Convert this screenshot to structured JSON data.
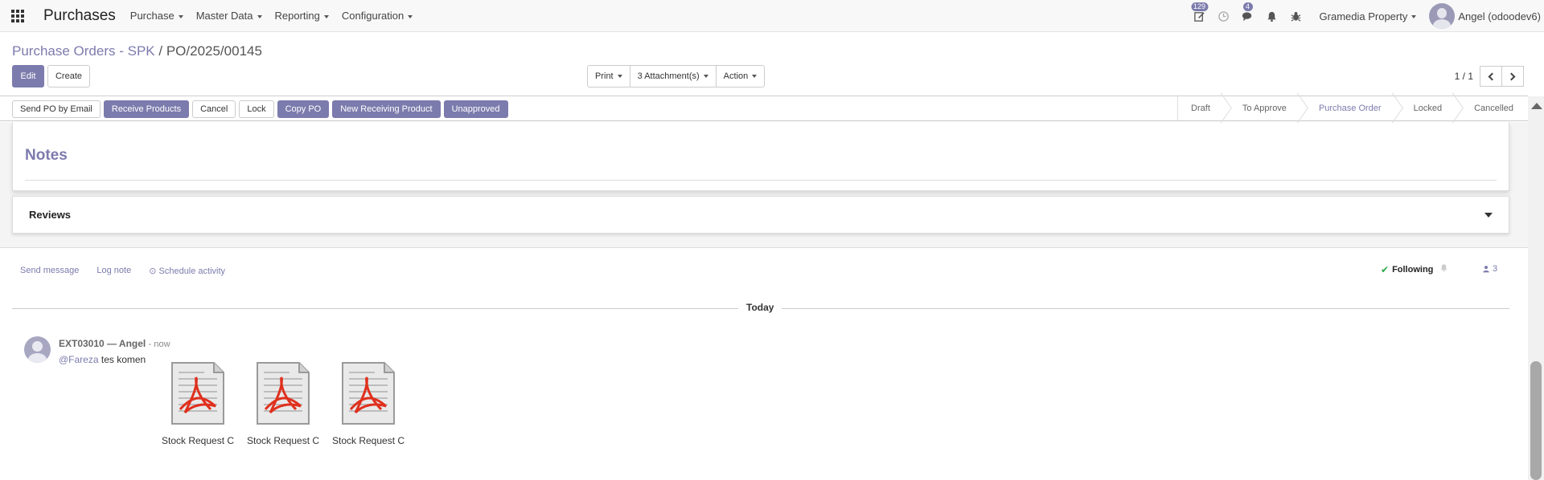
{
  "navbar": {
    "brand": "Purchases",
    "menus": [
      "Purchase",
      "Master Data",
      "Reporting",
      "Configuration"
    ],
    "activity_badge": "129",
    "messages_badge": "4",
    "company": "Gramedia Property",
    "user": "Angel (odoodev6)"
  },
  "breadcrumb": {
    "parent": "Purchase Orders - SPK",
    "separator": "/",
    "current": "PO/2025/00145"
  },
  "buttons": {
    "edit": "Edit",
    "create": "Create",
    "print": "Print",
    "attachments": "3 Attachment(s)",
    "action": "Action"
  },
  "pager": {
    "value": "1 / 1"
  },
  "status_actions": [
    "Send PO by Email",
    "Receive Products",
    "Cancel",
    "Lock",
    "Copy PO",
    "New Receiving Product",
    "Unapproved"
  ],
  "stages": [
    "Draft",
    "To Approve",
    "Purchase Order",
    "Locked",
    "Cancelled"
  ],
  "active_stage": "Purchase Order",
  "sheet": {
    "notes_title": "Notes",
    "reviews_label": "Reviews"
  },
  "chatter": {
    "send_message": "Send message",
    "log_note": "Log note",
    "schedule_activity": "Schedule activity",
    "following": "Following",
    "followers_count": "3",
    "date_separator": "Today",
    "message": {
      "author": "EXT03010 — Angel",
      "time": "- now",
      "mention": "@Fareza",
      "text": " tes komen",
      "attachments": [
        "Stock Request C",
        "Stock Request C",
        "Stock Request C"
      ]
    }
  },
  "colors": {
    "primary": "#7c7bad",
    "following_check": "#28a745"
  }
}
